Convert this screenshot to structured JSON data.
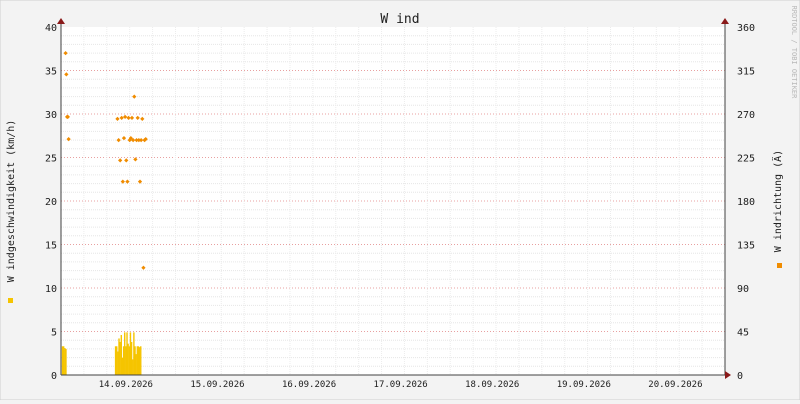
{
  "watermark": "RRDTOOL / TOBI OETIKER",
  "chart_data": {
    "type": "line",
    "title": "W ind",
    "xlabel": "",
    "ylabel_left": "W indgeschwindigkeit (km/h)",
    "ylabel_right": "W indrichtung (Ä)",
    "x_tick_labels": [
      "14.09.2026",
      "15.09.2026",
      "16.09.2026",
      "17.09.2026",
      "18.09.2026",
      "19.09.2026",
      "20.09.2026"
    ],
    "y_left_ticks": [
      0,
      5,
      10,
      15,
      20,
      25,
      30,
      35,
      40
    ],
    "y_right_ticks": [
      0,
      45,
      90,
      135,
      180,
      225,
      270,
      315,
      360
    ],
    "ylim_left": [
      0,
      40
    ],
    "ylim_right": [
      0,
      360
    ],
    "x_unit": "hours since 13.09.2026 19:00",
    "xlim": [
      0,
      174
    ],
    "grid": true,
    "legend_markers": [
      {
        "side": "left",
        "color": "#f5c400"
      },
      {
        "side": "right",
        "color": "#f08c00"
      }
    ],
    "series": [
      {
        "axis": "left",
        "kind": "bars",
        "color": "#f5c400",
        "x": [
          0.4,
          0.7,
          1.0,
          1.3,
          14.3,
          14.6,
          14.9,
          15.2,
          15.5,
          15.8,
          16.1,
          16.4,
          16.7,
          17.0,
          17.3,
          17.6,
          17.9,
          18.2,
          18.5,
          18.8,
          19.1,
          19.4,
          19.7,
          20.0,
          20.3,
          20.6,
          20.9,
          21.2,
          21.5,
          21.8
        ],
        "values": [
          3.3,
          3.3,
          3.1,
          3.0,
          3.3,
          3.3,
          2.7,
          4.2,
          3.8,
          4.6,
          2.0,
          3.3,
          4.9,
          3.3,
          4.9,
          3.6,
          3.3,
          4.9,
          3.8,
          1.8,
          4.9,
          3.3,
          2.4,
          3.3,
          3.3,
          3.2,
          3.3,
          0.0,
          0.0,
          0.0
        ]
      },
      {
        "axis": "right",
        "kind": "points",
        "color": "#f08c00",
        "x": [
          1.2,
          1.4,
          1.6,
          1.8,
          2.0,
          14.8,
          15.1,
          15.5,
          15.9,
          16.2,
          16.5,
          16.8,
          17.1,
          17.4,
          17.7,
          18.0,
          18.3,
          18.6,
          18.9,
          19.2,
          19.5,
          19.8,
          20.1,
          20.4,
          20.7,
          21.0,
          21.3,
          21.6,
          21.9,
          22.2
        ],
        "values": [
          333,
          311,
          267,
          267,
          244,
          265,
          243,
          222,
          266,
          200,
          245,
          267,
          222,
          200,
          266,
          243,
          245,
          266,
          243,
          288,
          223,
          243,
          266,
          243,
          200,
          243,
          265,
          111,
          243,
          244
        ]
      }
    ]
  }
}
